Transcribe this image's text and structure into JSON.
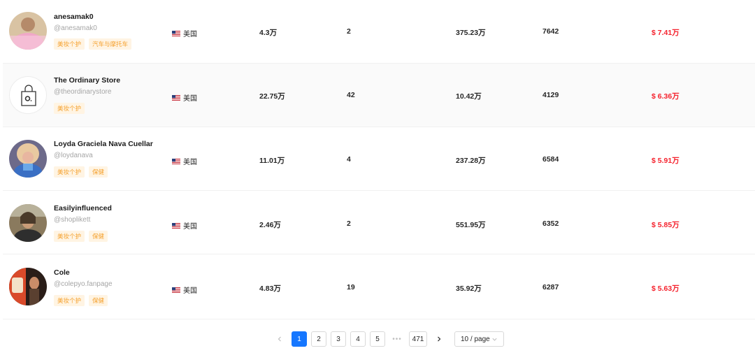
{
  "rows": [
    {
      "name": "anesamak0",
      "handle": "@anesamak0",
      "tags": [
        "美妆个护",
        "汽车与摩托车"
      ],
      "country": "美国",
      "fans": "4.3万",
      "count": "2",
      "views": "375.23万",
      "num": "7642",
      "price": "$ 7.41万"
    },
    {
      "name": "The Ordinary Store",
      "handle": "@theordinarystore",
      "tags": [
        "美妆个护"
      ],
      "country": "美国",
      "fans": "22.75万",
      "count": "42",
      "views": "10.42万",
      "num": "4129",
      "price": "$ 6.36万"
    },
    {
      "name": "Loyda Graciela Nava Cuellar",
      "handle": "@loydanava",
      "tags": [
        "美妆个护",
        "保健"
      ],
      "country": "美国",
      "fans": "11.01万",
      "count": "4",
      "views": "237.28万",
      "num": "6584",
      "price": "$ 5.91万"
    },
    {
      "name": "Easilyinfluenced",
      "handle": "@shoplikett",
      "tags": [
        "美妆个护",
        "保健"
      ],
      "country": "美国",
      "fans": "2.46万",
      "count": "2",
      "views": "551.95万",
      "num": "6352",
      "price": "$ 5.85万"
    },
    {
      "name": "Cole",
      "handle": "@colepyo.fanpage",
      "tags": [
        "美妆个护",
        "保健"
      ],
      "country": "美国",
      "fans": "4.83万",
      "count": "19",
      "views": "35.92万",
      "num": "6287",
      "price": "$ 5.63万"
    }
  ],
  "pagination": {
    "prev_icon": "chevron-left-icon",
    "pages": [
      "1",
      "2",
      "3",
      "4",
      "5"
    ],
    "ellipsis": "•••",
    "last_page": "471",
    "next_icon": "chevron-right-icon",
    "page_size": "10 / page",
    "current": "1"
  },
  "colors": {
    "price": "#f5222d",
    "tag_text": "#f5a12e",
    "tag_bg": "#fff4e3",
    "pager_active": "#1677ff"
  }
}
